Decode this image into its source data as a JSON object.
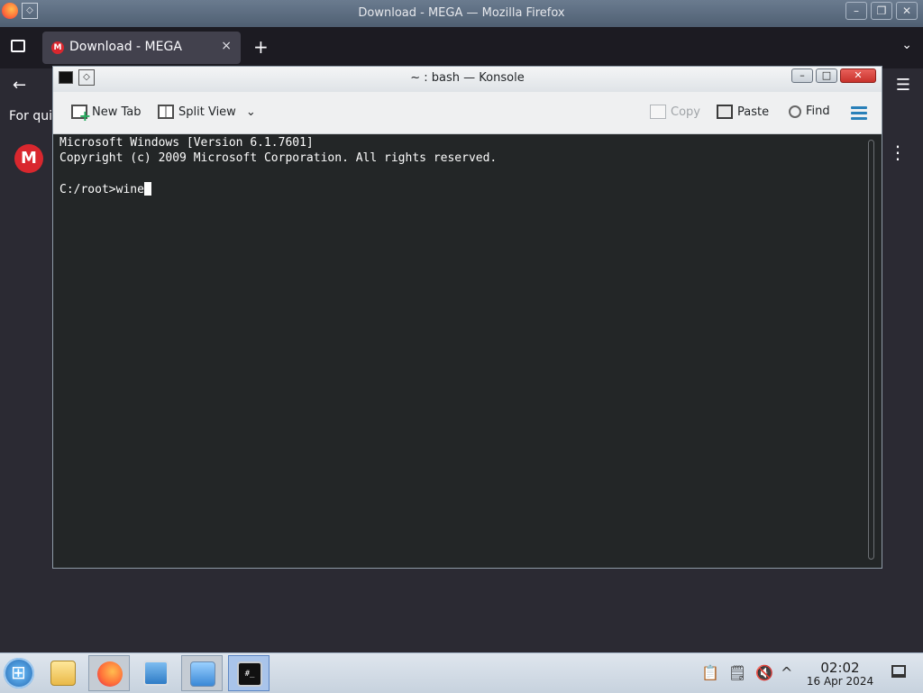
{
  "firefox": {
    "window_title": "Download - MEGA — Mozilla Firefox",
    "tab_label": "Download - MEGA",
    "tab_favicon": "M",
    "tab_close": "×",
    "new_tab": "+",
    "tab_list": "⌄",
    "pin": "◇",
    "min": "–",
    "max": "❐",
    "close": "✕",
    "back": "←",
    "menu": "☰",
    "quick_find_text": "For qui",
    "mega_logo": "M",
    "kebab": "⋮"
  },
  "konsole": {
    "title": "~ : bash — Konsole",
    "pin": "◇",
    "min": "–",
    "max": "□",
    "close": "✕",
    "toolbar": {
      "new_tab": "New Tab",
      "split_view": "Split View",
      "split_chevron": "⌄",
      "copy": "Copy",
      "paste": "Paste",
      "find": "Find"
    },
    "terminal_lines": [
      "Microsoft Windows [Version 6.1.7601]",
      "Copyright (c) 2009 Microsoft Corporation. All rights reserved.",
      "",
      "C:/root>wine"
    ]
  },
  "taskbar": {
    "konsole_glyph": "#_",
    "tray_chevron": "^",
    "time": "02:02",
    "date": "16 Apr 2024"
  },
  "icons": {
    "start": "windows-start-icon",
    "apps": [
      "folder-icon",
      "firefox-icon",
      "monitor-icon",
      "installer-icon",
      "konsole-icon"
    ],
    "tray": [
      "clipboard-icon",
      "notes-icon",
      "volume-muted-icon",
      "tray-expand-icon"
    ]
  }
}
